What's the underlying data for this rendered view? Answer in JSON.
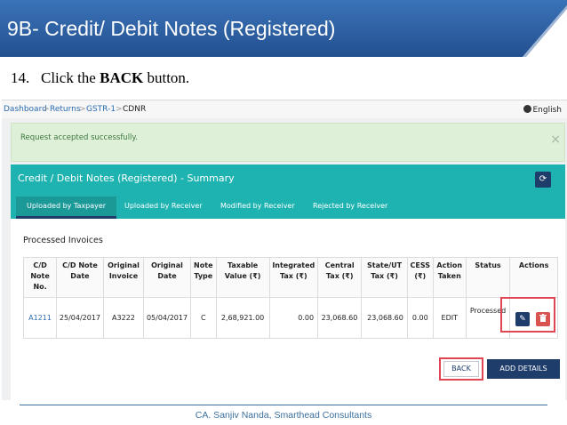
{
  "slide": {
    "title": "9B- Credit/ Debit Notes (Registered)",
    "step_number": "14.",
    "step_prefix": "Click the",
    "step_emphasis": "BACK",
    "step_suffix": "button.",
    "footer": "CA. Sanjiv Nanda, Smarthead Consultants"
  },
  "breadcrumb": {
    "items": [
      "Dashboard",
      "Returns",
      "GSTR-1",
      "CDNR"
    ],
    "separator": ">",
    "language": "English",
    "language_icon": "globe-icon"
  },
  "alert": {
    "message": "Request accepted successfully.",
    "close": "×"
  },
  "panel": {
    "title": "Credit / Debit Notes (Registered) - Summary",
    "refresh_icon": "⟳",
    "tabs": [
      "Uploaded by Taxpayer",
      "Uploaded by Receiver",
      "Modified by Receiver",
      "Rejected by Receiver"
    ],
    "active_tab": 0,
    "section_title": "Processed Invoices"
  },
  "table": {
    "headers": [
      "C/D Note No.",
      "C/D Note Date",
      "Original Invoice",
      "Original Date",
      "Note Type",
      "Taxable Value (₹)",
      "Integrated Tax (₹)",
      "Central Tax (₹)",
      "State/UT Tax (₹)",
      "CESS (₹)",
      "Action Taken",
      "Status",
      "Actions"
    ],
    "rows": [
      {
        "note_no": "A1211",
        "note_date": "25/04/2017",
        "original_invoice": "A3222",
        "original_date": "05/04/2017",
        "note_type": "C",
        "taxable_value": "2,68,921.00",
        "integrated_tax": "0.00",
        "central_tax": "23,068.60",
        "state_tax": "23,068.60",
        "cess": "0.00",
        "action_taken": "EDIT",
        "status": "Processed"
      }
    ],
    "edit_icon": "✎",
    "delete_icon": "🗑"
  },
  "buttons": {
    "back": "BACK",
    "add_details": "ADD DETAILS"
  },
  "colors": {
    "banner": "#2a5d9f",
    "panel_header": "#1eb3b0",
    "primary_button": "#1f3d6b",
    "highlight": "#e04553",
    "alert_bg": "#dff0d8"
  }
}
